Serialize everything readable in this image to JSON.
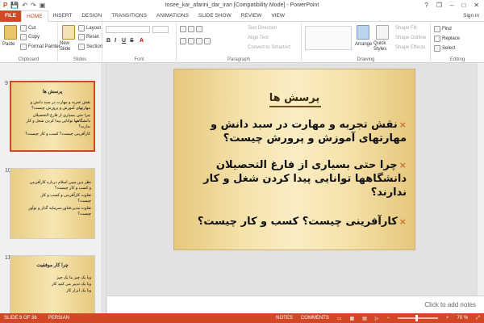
{
  "window": {
    "title": "tosee_kar_afarini_dar_iran [Compatibility Mode] - PowerPoint",
    "controls": {
      "help": "?",
      "restore": "❐",
      "minimize": "–",
      "maximize": "□",
      "close": "✕"
    }
  },
  "qat": {
    "save": "💾",
    "undo": "↶",
    "redo": "↷",
    "start": "▣"
  },
  "tabs": [
    "FILE",
    "HOME",
    "INSERT",
    "DESIGN",
    "TRANSITIONS",
    "ANIMATIONS",
    "SLIDE SHOW",
    "REVIEW",
    "VIEW"
  ],
  "active_tab": "HOME",
  "signin": "Sign in",
  "ribbon": {
    "clipboard": {
      "label": "Clipboard",
      "paste": "Paste",
      "cut": "Cut",
      "copy": "Copy",
      "format_painter": "Format Painter"
    },
    "slides": {
      "label": "Slides",
      "new_slide": "New Slide",
      "layout": "Layout",
      "reset": "Reset",
      "section": "Section"
    },
    "font": {
      "label": "Font",
      "bold": "B",
      "italic": "I",
      "underline": "U",
      "strike": "S"
    },
    "paragraph": {
      "label": "Paragraph",
      "text_direction": "Text Direction",
      "align_text": "Align Text",
      "convert": "Convert to SmartArt"
    },
    "drawing": {
      "label": "Drawing",
      "arrange": "Arrange",
      "quick_styles": "Quick Styles",
      "shape_fill": "Shape Fill",
      "shape_outline": "Shape Outline",
      "shape_effects": "Shape Effects"
    },
    "editing": {
      "label": "Editing",
      "find": "Find",
      "replace": "Replace",
      "select": "Select"
    }
  },
  "thumbnails": [
    {
      "num": "9",
      "title": "پرسش ها",
      "lines": [
        "نقش تجربه و مهارت در سبد دانش و",
        "مهارتهای آموزش و پرورش چیست؟",
        "چرا حتی بسیاری از فارغ التحصیلان",
        "دانشگاهها توانایی پیدا کردن شغل و کار",
        "ندارند؟",
        "کارآفرینی چیست؟ کسب و کار چیست؟"
      ]
    },
    {
      "num": "10",
      "title": "",
      "lines": [
        "نظر دین مبین اسلام درباره کارآفرینی",
        "و کسب و کار چیست؟",
        "تفاوت کارآفرینی و کسب و کار",
        "چیست؟",
        "تفاوت مدیر،فناور،سرمایه گذار و نوآور",
        "چیست؟"
      ]
    },
    {
      "num": "11",
      "title": "چرا کار موفقیت",
      "lines": [
        "وبا یک چیز ما یک چیز",
        "وبا یک تدبیر می کنید کار",
        "وبا یک ابزار کار"
      ]
    }
  ],
  "slide": {
    "title": "پرسش ها",
    "bullet_glyph": "×",
    "paragraphs": [
      [
        "نقش تجربه و مهارت در سبد دانش و",
        "مهارتهای آموزش و پرورش چیست؟"
      ],
      [
        "چرا حتی بسیاری از فارغ التحصیلان",
        "دانشگاهها توانایی پیدا کردن شغل و کار",
        "ندارند؟"
      ],
      [
        "کارآفرینی چیست؟ کسب و کار چیست؟"
      ]
    ]
  },
  "notes_placeholder": "Click to add notes",
  "status": {
    "slide": "SLIDE 9 OF 36",
    "language": "PERSIAN",
    "notes": "NOTES",
    "comments": "COMMENTS",
    "zoom": "70 %"
  },
  "colors": {
    "accent": "#d24726",
    "slide_gold": "#f6e3ad",
    "bullet": "#c9712b"
  }
}
